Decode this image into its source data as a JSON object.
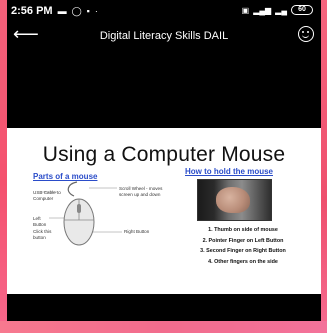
{
  "statusbar": {
    "time": "2:56 PM",
    "battery": "60"
  },
  "appbar": {
    "title": "Digital Literacy Skills DAIL"
  },
  "slide": {
    "title": "Using a Computer Mouse",
    "parts_heading": "Parts of a mouse",
    "hold_heading": "How to hold the mouse",
    "labels": {
      "usb": "USB Cable to Computer",
      "scroll": "Scroll Wheel - moves screen up and down",
      "left": "Left Button",
      "click": "Click this button",
      "right": "Right Button"
    },
    "steps": [
      "1. Thumb on side of mouse",
      "2. Pointer Finger on Left Button",
      "3. Second Finger on Right Button",
      "4. Other fingers on the side"
    ]
  }
}
